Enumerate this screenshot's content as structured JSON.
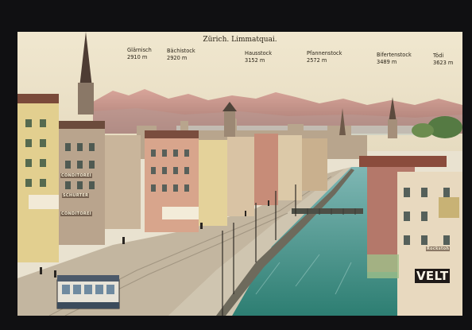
{
  "postcard": {
    "title": "Zürich. Limmatquai.",
    "peaks": [
      {
        "name": "Glärnisch",
        "height": "2910 m"
      },
      {
        "name": "Bächistock",
        "height": "2920 m"
      },
      {
        "name": "Hausstock",
        "height": "3152 m"
      },
      {
        "name": "Pfannenstock",
        "height": "2572 m"
      },
      {
        "name": "Bifertenstock",
        "height": "3489 m"
      },
      {
        "name": "Tödi",
        "height": "3623 m"
      }
    ],
    "signs": {
      "conditorei": "CONDITOREI",
      "schurter": "SCHURTER",
      "conditorei2": "CONDITOREI",
      "rockstoh": "Rockstoh",
      "velt": "VELT"
    }
  }
}
